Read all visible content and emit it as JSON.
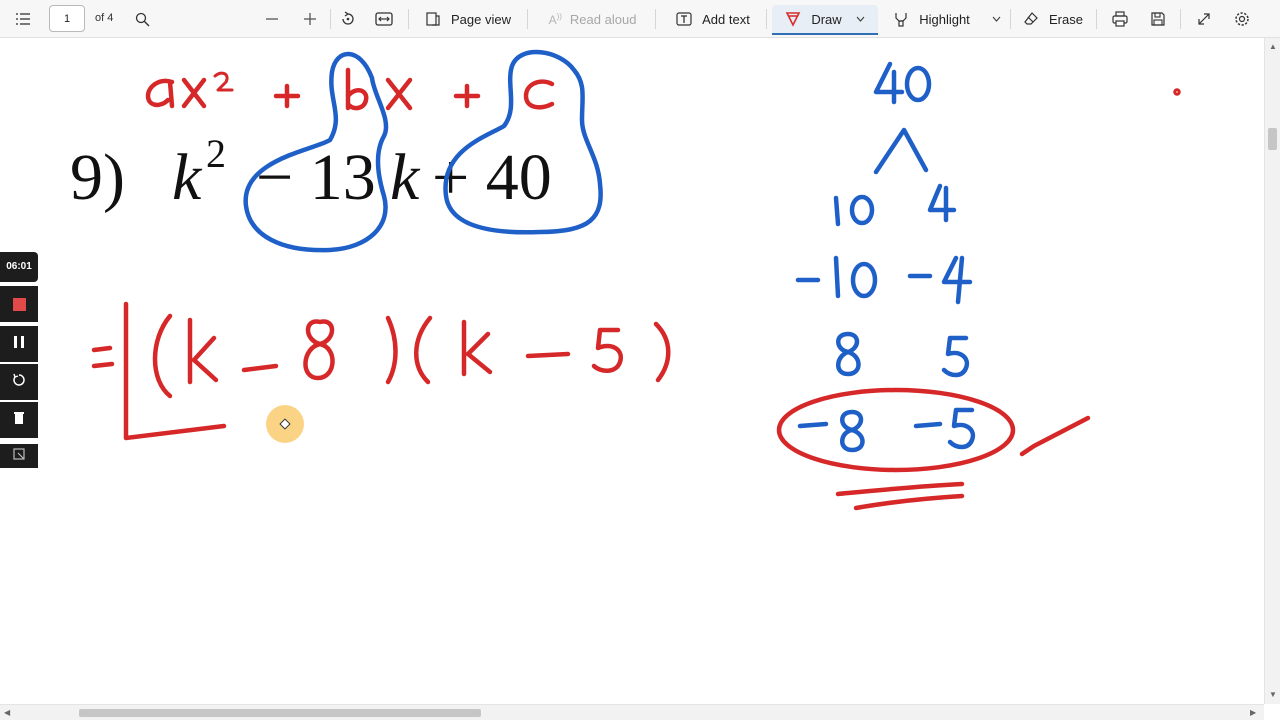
{
  "toolbar": {
    "page_number": "1",
    "page_count_label": "of 4",
    "page_view_label": "Page view",
    "read_aloud_label": "Read aloud",
    "add_text_label": "Add text",
    "draw_label": "Draw",
    "highlight_label": "Highlight",
    "erase_label": "Erase",
    "draw_color": "#d62d2d",
    "accent": "#2f6fb5"
  },
  "document": {
    "problem_number": "9)",
    "variable": "k",
    "exponent": "2",
    "middle_term": "− 13",
    "variable2": "k",
    "last_term": "+ 40"
  },
  "recorder": {
    "time": "06:01"
  },
  "ink_colors": {
    "red": "#d62828",
    "blue": "#1f5fc8"
  },
  "icons": [
    "contents-icon",
    "search-icon",
    "zoom-out-icon",
    "zoom-in-icon",
    "rotate-icon",
    "fit-width-icon",
    "page-view-icon",
    "read-aloud-icon",
    "add-text-icon",
    "draw-icon",
    "chevron-down-icon",
    "highlight-icon",
    "erase-icon",
    "print-icon",
    "save-icon",
    "fullscreen-icon",
    "settings-icon"
  ]
}
